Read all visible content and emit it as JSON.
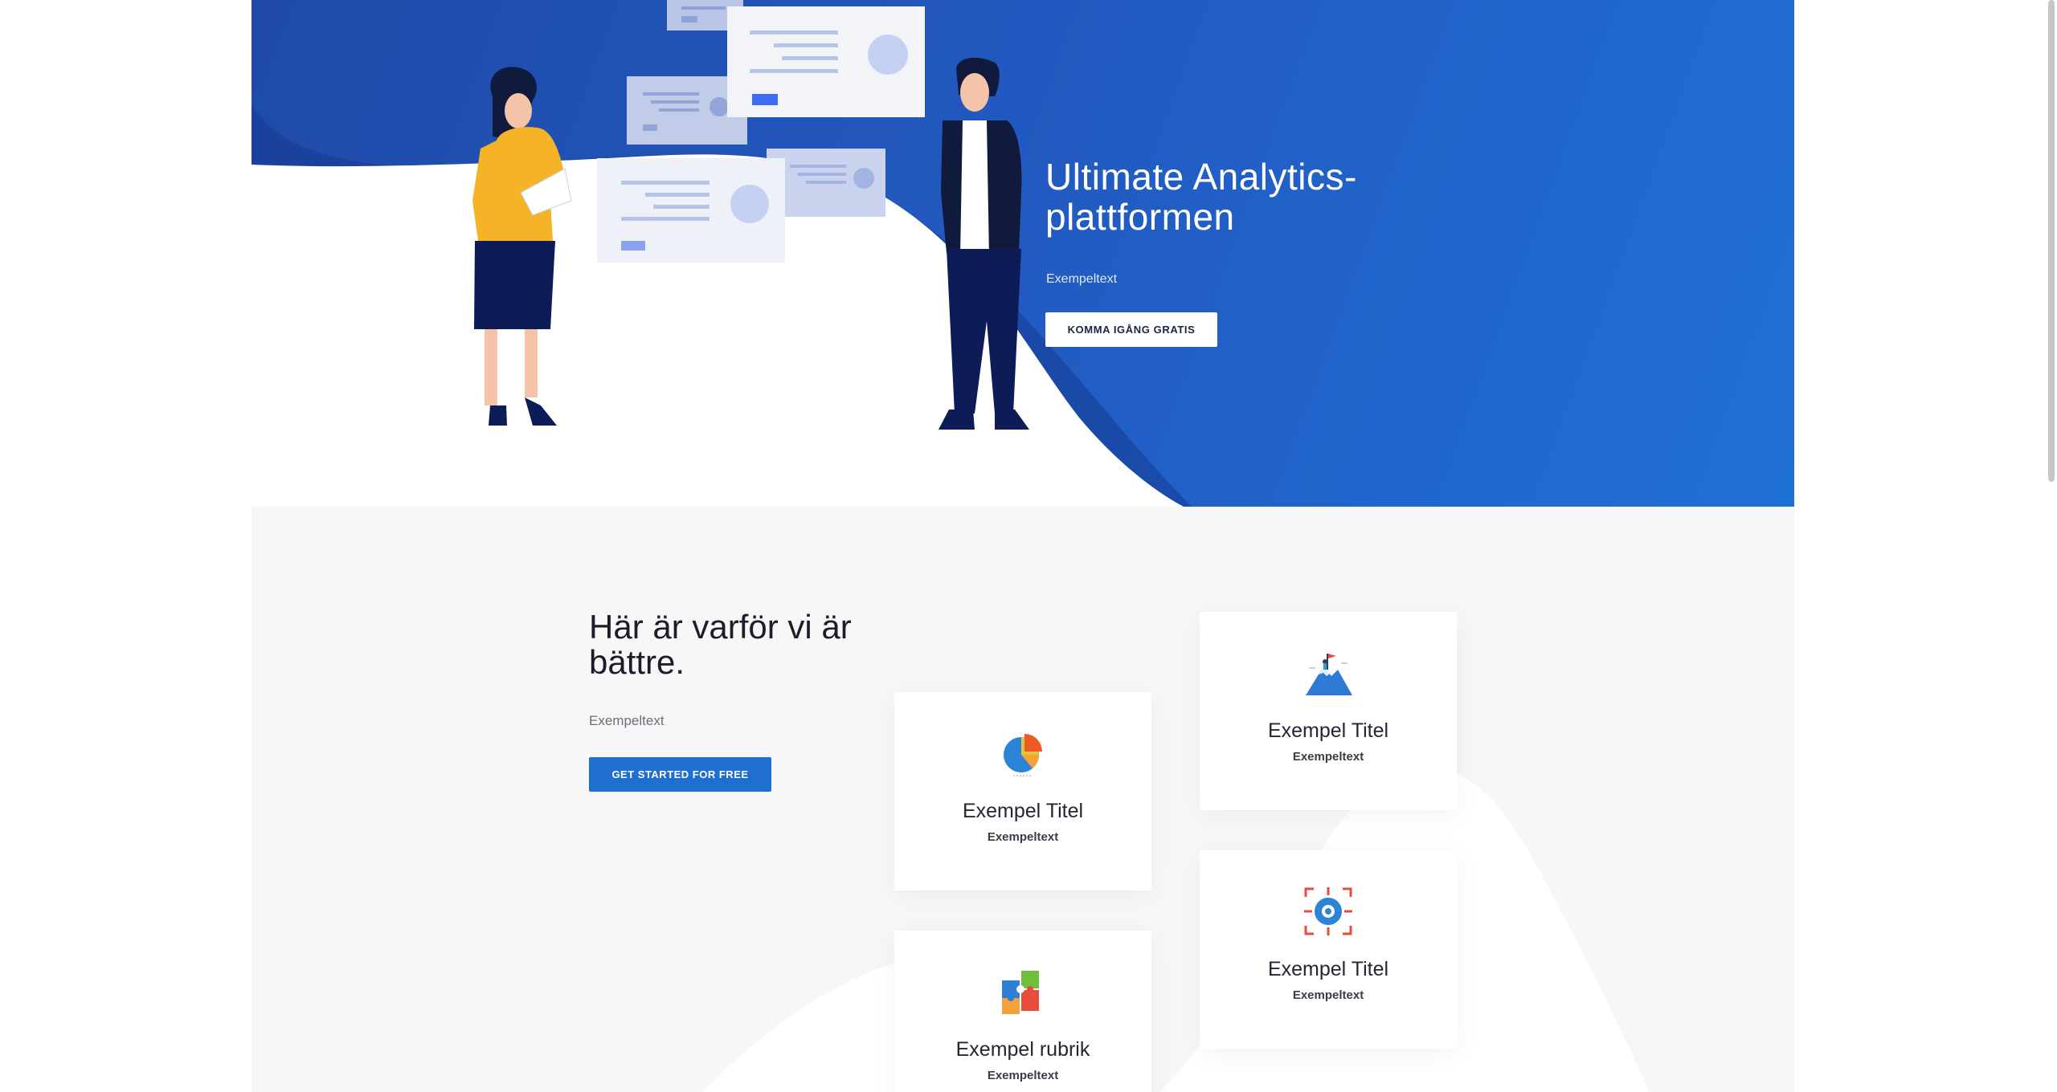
{
  "hero": {
    "title": "Ultimate Analytics-plattformen",
    "subtitle": "Exempeltext",
    "cta_label": "KOMMA IGÅNG GRATIS"
  },
  "features": {
    "title": "Här är varför vi är bättre.",
    "subtitle": "Exempeltext",
    "cta_label": "GET STARTED FOR FREE",
    "cards": [
      {
        "title": "Exempel Titel",
        "text": "Exempeltext",
        "icon": "pie-chart-icon"
      },
      {
        "title": "Exempel Titel",
        "text": "Exempeltext",
        "icon": "mountain-flag-icon"
      },
      {
        "title": "Exempel rubrik",
        "text": "Exempeltext",
        "icon": "puzzle-icon"
      },
      {
        "title": "Exempel Titel",
        "text": "Exempeltext",
        "icon": "target-icon"
      }
    ]
  },
  "colors": {
    "hero_gradient_start": "#1f4aa8",
    "hero_gradient_end": "#1f70d6",
    "primary_button": "#1f6fd0",
    "section_background": "#f7f7f7"
  }
}
